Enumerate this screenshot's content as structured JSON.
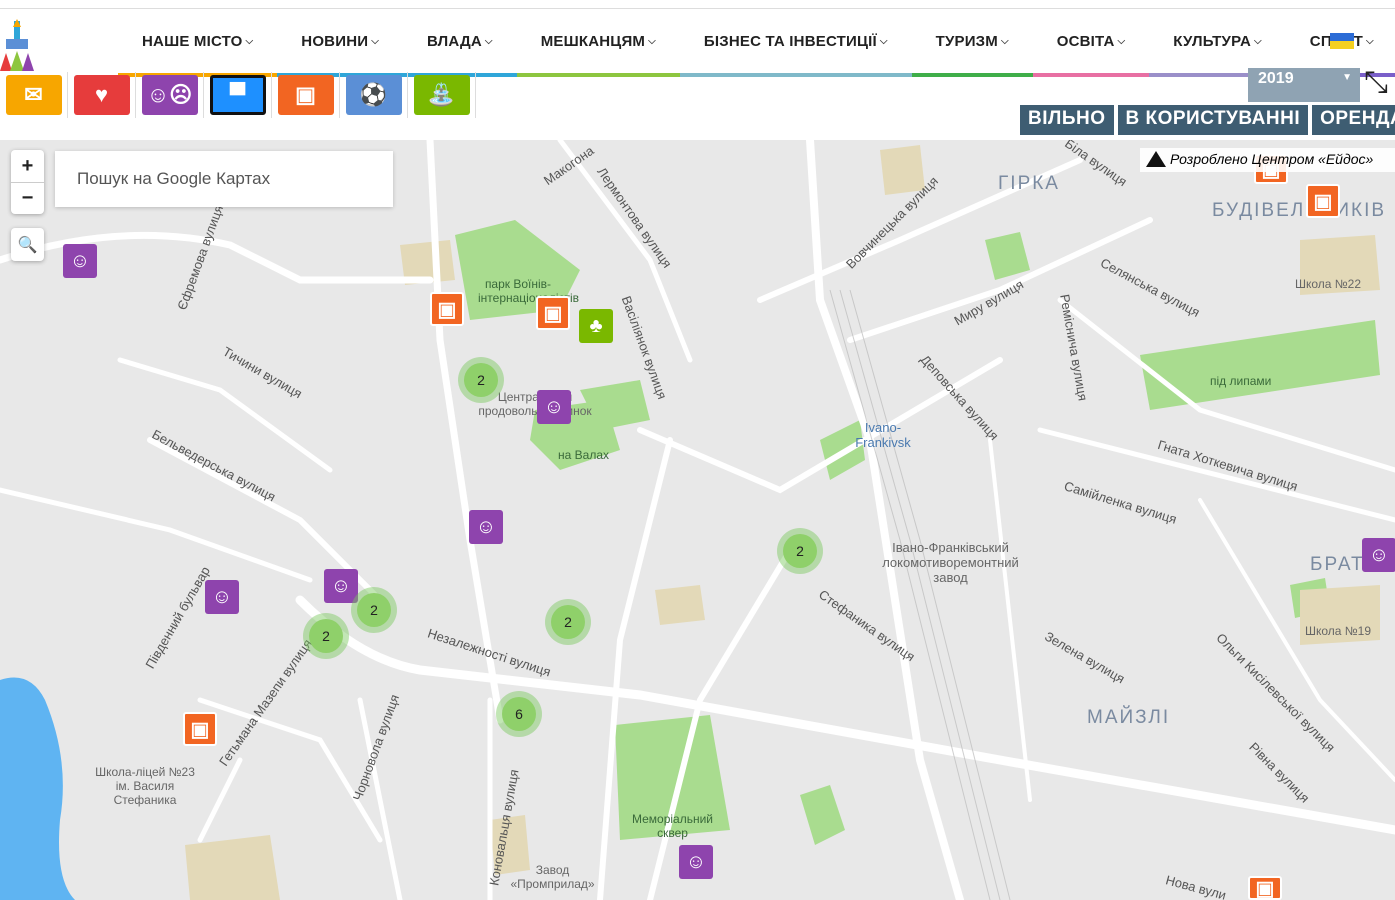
{
  "nav": {
    "items": [
      {
        "label": "НАШЕ МІСТО",
        "color": "#f7a600"
      },
      {
        "label": "НОВИНИ",
        "color": "#2fa6d9"
      },
      {
        "label": "ВЛАДА",
        "color": "#2fa6d9"
      },
      {
        "label": "МЕШКАНЦЯМ",
        "color": "#8dc63f"
      },
      {
        "label": "БІЗНЕС ТА ІНВЕСТИЦІЇ",
        "color": "#7fb9c9"
      },
      {
        "label": "ТУРИЗМ",
        "color": "#3fae49"
      },
      {
        "label": "ОСВІТА",
        "color": "#e86fa3"
      },
      {
        "label": "КУЛЬТУРА",
        "color": "#9a8fc9"
      },
      {
        "label": "СПОРТ",
        "color": "#7a5fc9"
      }
    ]
  },
  "categories": [
    {
      "icon": "envelope-icon",
      "color": "#f7a600"
    },
    {
      "icon": "heartbeat-icon",
      "color": "#e63c3c"
    },
    {
      "icon": "theatre-masks-icon",
      "color": "#8e44ad"
    },
    {
      "icon": "bus-icon",
      "color": "#1e90ff"
    },
    {
      "icon": "office-icon",
      "color": "#f26522"
    },
    {
      "icon": "soccer-ball-icon",
      "color": "#5b8fd6"
    },
    {
      "icon": "park-bench-icon",
      "color": "#7ab800"
    }
  ],
  "year": "2019",
  "status_buttons": [
    "ВІЛЬНО",
    "В КОРИСТУВАННІ",
    "ОРЕНДА"
  ],
  "map": {
    "search_placeholder": "Пошук на Google Картах",
    "zoom_in": "+",
    "zoom_out": "−",
    "credit": "Розроблено Центром «Ейдос»",
    "districts": [
      "ГІРКА",
      "БУДІВЕЛЬНИКІВ",
      "МАЙЗЛІ",
      "БРАТ"
    ],
    "streets": [
      "Макогона",
      "Лермонтова вулиця",
      "Васіліянок вулиця",
      "Вовчинецька вулиця",
      "Біла вулиця",
      "Селянська вулиця",
      "Миру вулиця",
      "Ремісничa вулиця",
      "Деповська вулиця",
      "Гната Хоткевича вулиця",
      "Самійленка вулиця",
      "Тичини вулиця",
      "Бельведерська вулиця",
      "Єфремова вулиця",
      "Південний бульвар",
      "Гетьмана Мазепи вулиця",
      "Незалежності вулиця",
      "Стефаника вулиця",
      "Зелена вулиця",
      "Ольги Кисілевської вулиця",
      "Рівна вулиця",
      "Чорновола вулиця",
      "Коновальця вулиця",
      "Нова вули"
    ],
    "places": [
      "парк Воїнів-інтернаціоналістів",
      "Центральний продовольчий ринок",
      "на Валах",
      "Ivano-Frankivsk",
      "Івано-Франківський локомотиворемонтний завод",
      "під липами",
      "Школа №22",
      "Школа №19",
      "Школа-ліцей №23 ім. Василя Стефаника",
      "Меморіальний сквер",
      "Завод «Промприлад»"
    ],
    "clusters": [
      "2",
      "2",
      "2",
      "2",
      "2",
      "6"
    ]
  }
}
